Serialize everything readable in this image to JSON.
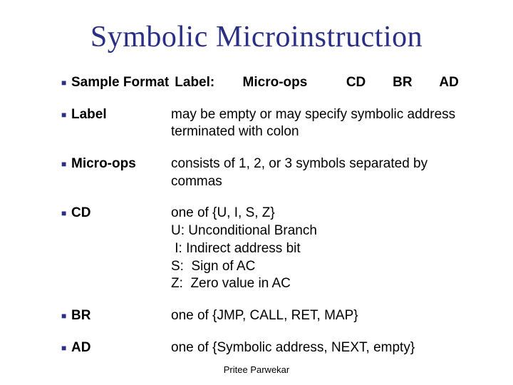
{
  "title": "Symbolic Microinstruction",
  "sample": {
    "heading": "Sample Format",
    "fields": {
      "label": "Label:",
      "microops": "Micro-ops",
      "cd": "CD",
      "br": "BR",
      "ad": "AD"
    }
  },
  "items": {
    "label": {
      "term": "Label",
      "desc": "may be empty or may specify symbolic address terminated with colon"
    },
    "microops": {
      "term": "Micro-ops",
      "desc": "consists of 1, 2, or 3 symbols separated by commas"
    },
    "cd": {
      "term": "CD",
      "line1": "one of {U, I, S, Z}",
      "line2": "U: Unconditional Branch",
      "line3": " I: Indirect address bit",
      "line4": "S:  Sign of AC",
      "line5": "Z:  Zero value in AC"
    },
    "br": {
      "term": "BR",
      "desc": "one of {JMP, CALL, RET, MAP}"
    },
    "ad": {
      "term": "AD",
      "desc": "one of {Symbolic address, NEXT, empty}"
    }
  },
  "footer": "Pritee Parwekar"
}
